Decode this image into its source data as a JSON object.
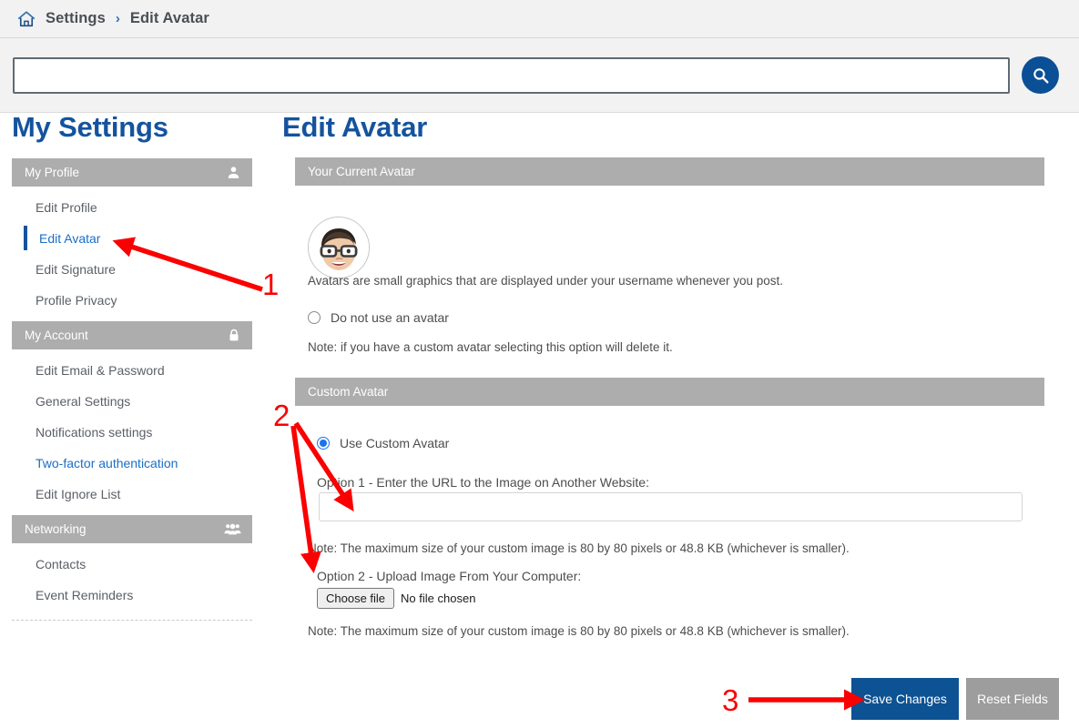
{
  "breadcrumb": {
    "home_icon": "home-icon",
    "items": [
      "Settings",
      "Edit Avatar"
    ],
    "separator": "›"
  },
  "search": {
    "value": "",
    "placeholder": "",
    "button_icon": "search-icon"
  },
  "sidebar": {
    "title": "My Settings",
    "groups": [
      {
        "header": "My Profile",
        "icon": "user-icon",
        "items": [
          {
            "label": "Edit Profile",
            "active": false,
            "highlighted": false
          },
          {
            "label": "Edit Avatar",
            "active": true,
            "highlighted": false
          },
          {
            "label": "Edit Signature",
            "active": false,
            "highlighted": false
          },
          {
            "label": "Profile Privacy",
            "active": false,
            "highlighted": false
          }
        ]
      },
      {
        "header": "My Account",
        "icon": "lock-icon",
        "items": [
          {
            "label": "Edit Email & Password",
            "active": false,
            "highlighted": false
          },
          {
            "label": "General Settings",
            "active": false,
            "highlighted": false
          },
          {
            "label": "Notifications settings",
            "active": false,
            "highlighted": false
          },
          {
            "label": "Two-factor authentication",
            "active": false,
            "highlighted": true
          },
          {
            "label": "Edit Ignore List",
            "active": false,
            "highlighted": false
          }
        ]
      },
      {
        "header": "Networking",
        "icon": "group-icon",
        "items": [
          {
            "label": "Contacts",
            "active": false,
            "highlighted": false
          },
          {
            "label": "Event Reminders",
            "active": false,
            "highlighted": false
          }
        ]
      }
    ]
  },
  "main": {
    "title": "Edit Avatar",
    "current_avatar": {
      "header": "Your Current Avatar",
      "avatar_icon": "memoji-avatar",
      "description": "Avatars are small graphics that are displayed under your username whenever you post.",
      "no_avatar_option": {
        "label": "Do not use an avatar",
        "selected": false
      },
      "delete_note": "Note: if you have a custom avatar selecting this option will delete it."
    },
    "custom_avatar": {
      "header": "Custom Avatar",
      "use_custom_option": {
        "label": "Use Custom Avatar",
        "selected": true
      },
      "option1_label": "Option 1 - Enter the URL to the Image on Another Website:",
      "option1_value": "",
      "option1_placeholder": "",
      "option1_note": "Note: The maximum size of your custom image is 80 by 80 pixels or 48.8 KB (whichever is smaller).",
      "option2_label": "Option 2 - Upload Image From Your Computer:",
      "file_button_label": "Choose file",
      "file_status": "No file chosen",
      "option2_note": "Note: The maximum size of your custom image is 80 by 80 pixels or 48.8 KB (whichever is smaller)."
    },
    "actions": {
      "save_label": "Save Changes",
      "reset_label": "Reset Fields"
    }
  },
  "annotations": {
    "color": "#fb0000",
    "markers": [
      {
        "number": "1",
        "target": "sidebar-item-edit-avatar"
      },
      {
        "number": "2",
        "target": "custom-avatar-url-and-file-inputs"
      },
      {
        "number": "3",
        "target": "save-changes-button"
      }
    ]
  },
  "colors": {
    "brand_blue": "#14539e",
    "link_blue": "#1a6fc4",
    "panel_gray": "#adadad",
    "button_primary": "#0d5293",
    "button_secondary": "#9d9d9d",
    "annotation_red": "#fb0000"
  }
}
